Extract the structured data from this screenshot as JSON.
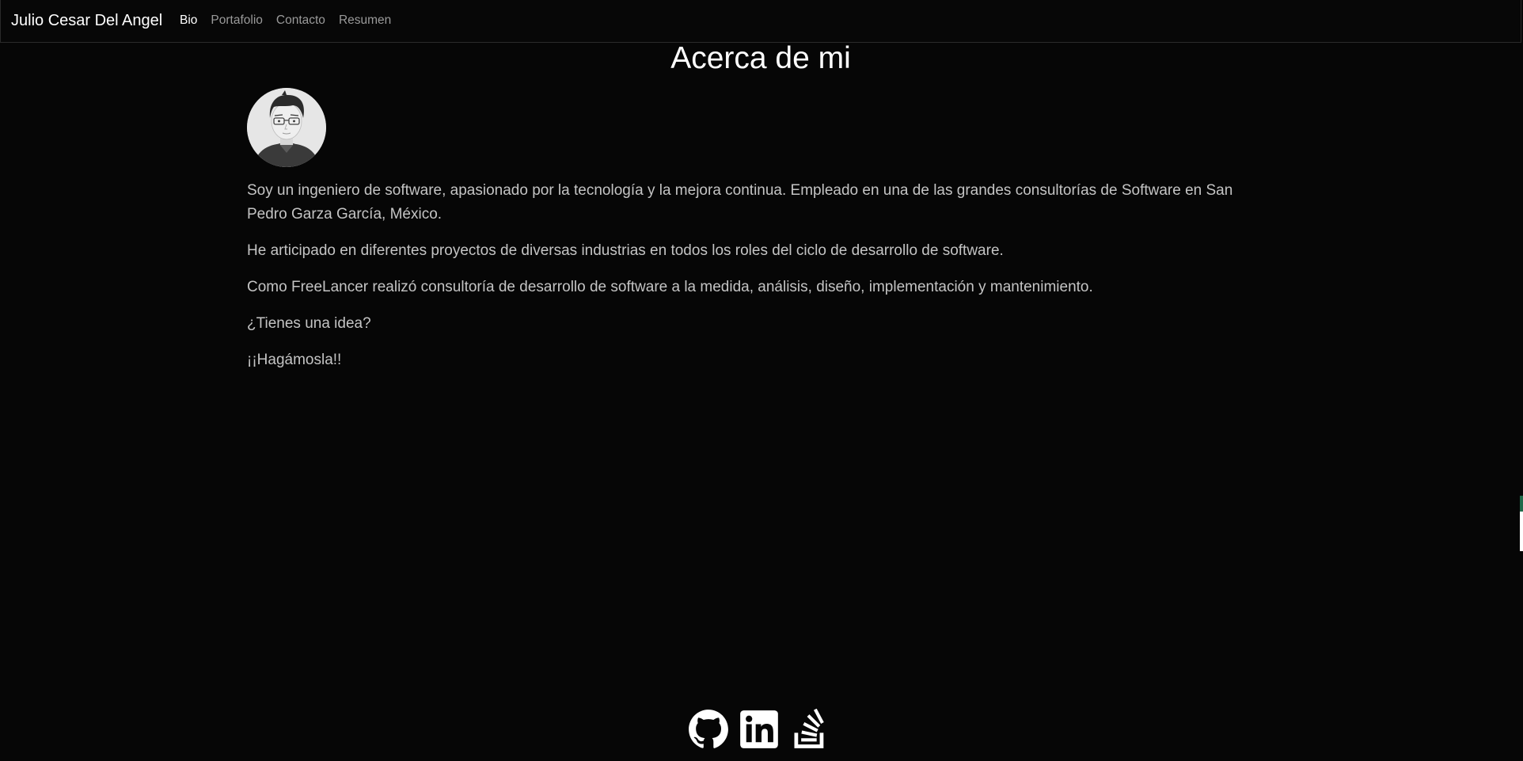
{
  "navbar": {
    "brand": "Julio Cesar Del Angel",
    "links": [
      {
        "label": "Bio",
        "active": true
      },
      {
        "label": "Portafolio",
        "active": false
      },
      {
        "label": "Contacto",
        "active": false
      },
      {
        "label": "Resumen",
        "active": false
      }
    ]
  },
  "main": {
    "title": "Acerca de mi",
    "paragraphs": [
      "Soy un ingeniero de software, apasionado por la tecnología y la mejora continua. Empleado en una de las grandes consultorías de Software en San Pedro Garza García, México.",
      "He articipado en diferentes proyectos de diversas industrias en todos los roles del ciclo de desarrollo de software.",
      "Como FreeLancer realizó consultoría de desarrollo de software a la medida, análisis, diseño, implementación y mantenimiento.",
      "¿Tienes una idea?",
      "¡¡Hagámosla!!"
    ]
  },
  "footer": {
    "icons": [
      "github-icon",
      "linkedin-icon",
      "stackoverflow-icon"
    ]
  },
  "colors": {
    "background": "#060606",
    "text": "#c4c4c4",
    "nav_inactive": "#9a9a9a",
    "title": "#ffffff"
  }
}
